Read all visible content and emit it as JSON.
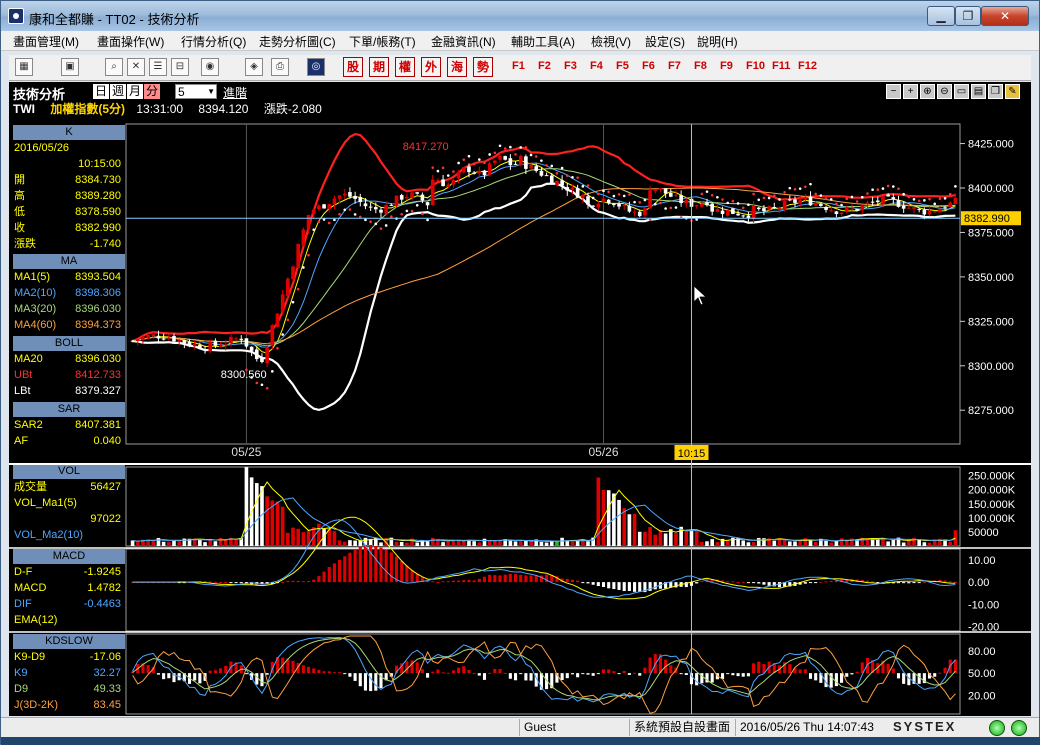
{
  "window": {
    "title": "康和全都賺 - TT02 - 技術分析",
    "minimize": "▁",
    "maximize": "❐",
    "close": "✕"
  },
  "menu": [
    "畫面管理(M)",
    "畫面操作(W)",
    "行情分析(Q)",
    "走勢分析圖(C)",
    "下單/帳務(T)",
    "金融資訊(N)",
    "輔助工具(A)",
    "檢視(V)",
    "設定(S)",
    "說明(H)"
  ],
  "toolbar": {
    "red_buttons": [
      "股",
      "期",
      "權",
      "外",
      "海",
      "勢"
    ],
    "fkeys": [
      "F1",
      "F2",
      "F3",
      "F4",
      "F5",
      "F6",
      "F7",
      "F8",
      "F9",
      "F10",
      "F11",
      "F12"
    ]
  },
  "panel": {
    "title": "技術分析",
    "periods": [
      "日",
      "週",
      "月",
      "分"
    ],
    "selected_period": "分",
    "minutes": "5",
    "advanced": "進階",
    "symbol": "TWI",
    "index_name": "加權指數(5分)",
    "time": "13:31:00",
    "price": "8394.120",
    "change": "漲跌-2.080"
  },
  "k_section": {
    "title": "K",
    "date": "2016/05/26",
    "time": "10:15:00",
    "rows": [
      {
        "label": "開",
        "value": "8384.730"
      },
      {
        "label": "高",
        "value": "8389.280"
      },
      {
        "label": "低",
        "value": "8378.590"
      },
      {
        "label": "收",
        "value": "8382.990"
      },
      {
        "label": "漲跌",
        "value": "-1.740"
      }
    ]
  },
  "ma_section": {
    "title": "MA",
    "rows": [
      {
        "label": "MA1(5)",
        "value": "8393.504",
        "color": "#ffff00"
      },
      {
        "label": "MA2(10)",
        "value": "8398.306",
        "color": "#4da6ff"
      },
      {
        "label": "MA3(20)",
        "value": "8396.030",
        "color": "#a8d878"
      },
      {
        "label": "MA4(60)",
        "value": "8394.373",
        "color": "#ffa040"
      }
    ]
  },
  "boll_section": {
    "title": "BOLL",
    "rows": [
      {
        "label": "MA20",
        "value": "8396.030",
        "color": "#ffff00"
      },
      {
        "label": "UBt",
        "value": "8412.733",
        "color": "#ff3030"
      },
      {
        "label": "LBt",
        "value": "8379.327",
        "color": "#ffffff"
      }
    ]
  },
  "sar_section": {
    "title": "SAR",
    "rows": [
      {
        "label": "SAR2",
        "value": "8407.381",
        "color": "#ffff00"
      },
      {
        "label": "AF",
        "value": "0.040",
        "color": "#ffff00"
      }
    ]
  },
  "vol_section": {
    "title": "VOL",
    "rows": [
      {
        "label": "成交量",
        "value": "56427",
        "color": "#ffff00"
      },
      {
        "label": "VOL_Ma1(5)",
        "value": "",
        "color": "#ffff00"
      },
      {
        "label": "",
        "value": "97022",
        "color": "#ffff00"
      },
      {
        "label": "VOL_Ma2(10)",
        "value": "",
        "color": "#4da6ff"
      }
    ]
  },
  "macd_section": {
    "title": "MACD",
    "rows": [
      {
        "label": "D-F",
        "value": "-1.9245",
        "color": "#ffff00"
      },
      {
        "label": "MACD",
        "value": "1.4782",
        "color": "#ffff00"
      },
      {
        "label": "DIF",
        "value": "-0.4463",
        "color": "#4da6ff"
      },
      {
        "label": "EMA(12)",
        "value": "",
        "color": "#ffff00"
      }
    ]
  },
  "kd_section": {
    "title": "KDSLOW",
    "rows": [
      {
        "label": "K9-D9",
        "value": "-17.06",
        "color": "#ffff00"
      },
      {
        "label": "K9",
        "value": "32.27",
        "color": "#4da6ff"
      },
      {
        "label": "D9",
        "value": "49.33",
        "color": "#a8d878"
      },
      {
        "label": "J(3D-2K)",
        "value": "83.45",
        "color": "#ffa040"
      }
    ]
  },
  "chart_data": {
    "type": "candlestick",
    "price_axis_ticks": [
      "8425.000",
      "8400.000",
      "8375.000",
      "8350.000",
      "8325.000",
      "8300.000",
      "8275.000"
    ],
    "ylim": [
      8256,
      8436
    ],
    "current_price_label": "8382.990",
    "annotations": [
      "8417.270",
      "8300.560"
    ],
    "x_ticks": [
      "05/25",
      "05/26"
    ],
    "crosshair_time": "10:15",
    "volume_axis_ticks": [
      "250.000K",
      "200.000K",
      "150.000K",
      "100.000K",
      "50000"
    ],
    "macd_axis_ticks": [
      "10.00",
      "0.00",
      "-10.00",
      "-20.00"
    ],
    "kd_axis_ticks": [
      "80.00",
      "50.00",
      "20.00"
    ],
    "colors": {
      "up": "#e00000",
      "down": "#ffffff",
      "ma5": "#ffff00",
      "ma10": "#4da6ff",
      "ma20": "#a8d878",
      "ma60": "#ffa040",
      "boll_upper": "#ff2020",
      "boll_lower": "#ffffff",
      "sar": "#ff3030"
    }
  },
  "status": {
    "user": "Guest",
    "screen": "系統預設自設畫面",
    "datetime": "2016/05/26 Thu 14:07:43",
    "brand": "SYSTEX"
  }
}
